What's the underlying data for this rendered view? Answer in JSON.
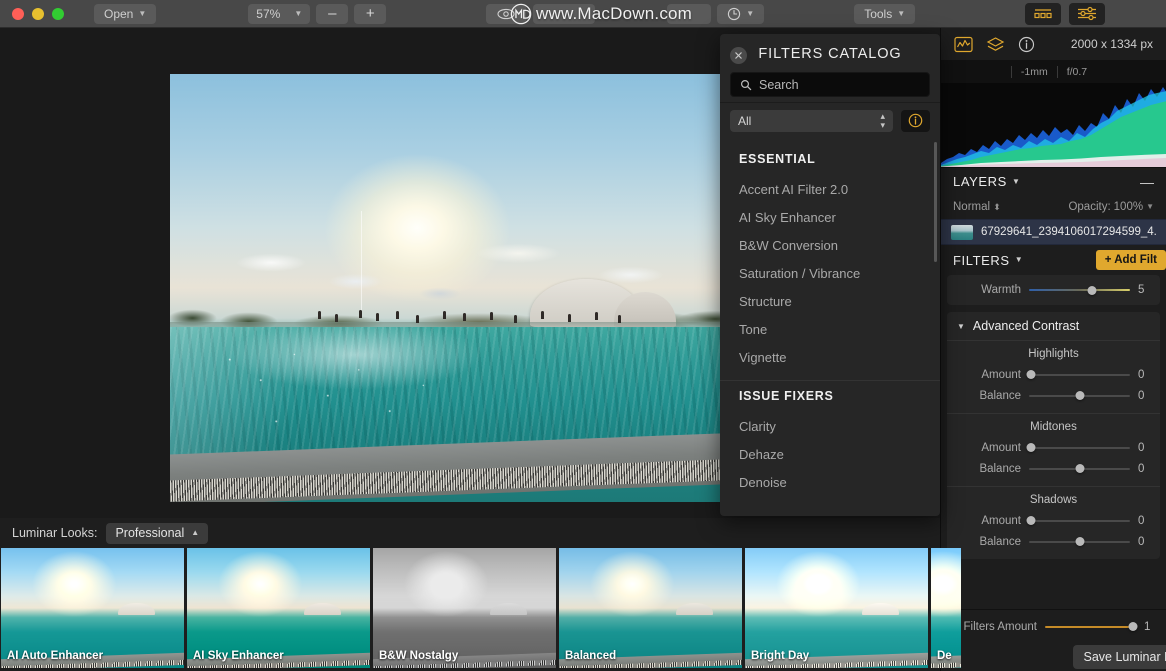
{
  "window": {
    "traffic_lights": [
      "close",
      "minimize",
      "zoom"
    ]
  },
  "toolbar": {
    "open_label": "Open",
    "zoom_value": "57%",
    "zoom_out": "–",
    "zoom_in": "+",
    "eye_icon": "eye-icon",
    "history_icon": "clock-icon",
    "tools_label": "Tools",
    "looks_toggle_icon": "looks-panel-icon",
    "filters_toggle_icon": "sliders-panel-icon"
  },
  "watermark": {
    "text": "www.MacDown.com"
  },
  "catalog": {
    "title": "FILTERS CATALOG",
    "close_icon": "close-icon",
    "search_placeholder": "Search",
    "search_value": "",
    "search_icon": "search-icon",
    "category_selected": "All",
    "info_icon": "info-icon",
    "groups": [
      {
        "title": "ESSENTIAL",
        "items": [
          "Accent AI Filter 2.0",
          "AI Sky Enhancer",
          "B&W Conversion",
          "Saturation / Vibrance",
          "Structure",
          "Tone",
          "Vignette"
        ]
      },
      {
        "title": "ISSUE FIXERS",
        "items": [
          "Clarity",
          "Dehaze",
          "Denoise"
        ]
      }
    ]
  },
  "right_panel": {
    "histogram_icon": "histogram-icon",
    "layers_icon": "layers-icon",
    "info_icon": "info-icon",
    "image_size": "2000 x 1334 px",
    "exif": [
      "-1mm",
      "f/0.7"
    ],
    "layers": {
      "title": "LAYERS",
      "collapse_icon": "minus-icon",
      "blend_mode": "Normal",
      "opacity_label": "Opacity:",
      "opacity_value": "100%",
      "layer_name": "67929641_2394106017294599_4..."
    },
    "filters": {
      "title": "FILTERS",
      "add_filter_label": "+ Add Filt",
      "warmth": {
        "label": "Warmth",
        "value": "5",
        "knob_pct": 62
      },
      "advanced_contrast": {
        "title": "Advanced Contrast",
        "groups": [
          {
            "label": "Highlights",
            "rows": [
              {
                "label": "Amount",
                "value": "0",
                "knob_pct": 2
              },
              {
                "label": "Balance",
                "value": "0",
                "knob_pct": 50
              }
            ]
          },
          {
            "label": "Midtones",
            "rows": [
              {
                "label": "Amount",
                "value": "0",
                "knob_pct": 2
              },
              {
                "label": "Balance",
                "value": "0",
                "knob_pct": 50
              }
            ]
          },
          {
            "label": "Shadows",
            "rows": [
              {
                "label": "Amount",
                "value": "0",
                "knob_pct": 2
              },
              {
                "label": "Balance",
                "value": "0",
                "knob_pct": 50
              }
            ]
          }
        ]
      },
      "filters_amount": {
        "label": "Filters Amount",
        "value": "1",
        "knob_pct": 97
      }
    },
    "save_look_label": "Save Luminar Lo"
  },
  "looks": {
    "label": "Luminar Looks:",
    "category": "Professional",
    "category_caret": "chevron-up-icon",
    "thumbnails": [
      {
        "name": "AI Auto Enhancer",
        "style": "t-auto"
      },
      {
        "name": "AI Sky Enhancer",
        "style": "t-sky2"
      },
      {
        "name": "B&W Nostalgy",
        "style": "t-bw"
      },
      {
        "name": "Balanced",
        "style": "t-balanced"
      },
      {
        "name": "Bright Day",
        "style": "t-bright"
      },
      {
        "name": "De",
        "style": "t-de"
      }
    ]
  },
  "colors": {
    "accent_gold": "#e0a82e",
    "panel_bg": "#1d1d1d",
    "toolbar_bg": "#484848",
    "catalog_bg": "#262626",
    "layer_selected": "#2d3447"
  }
}
